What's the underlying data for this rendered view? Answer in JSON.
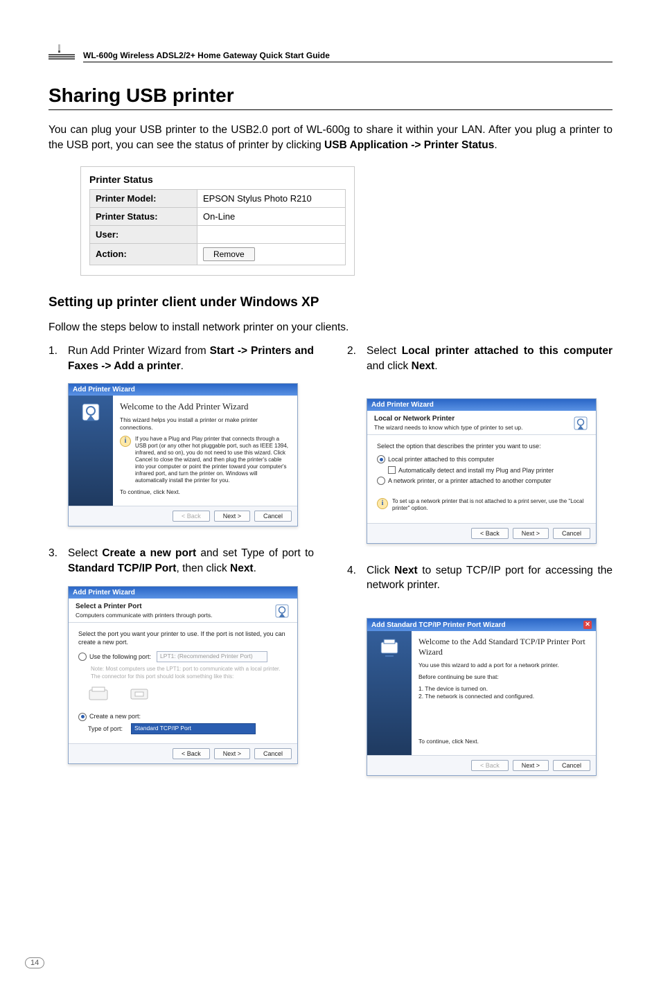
{
  "header": {
    "doc_title": "WL-600g Wireless ADSL2/2+ Home Gateway Quick Start Guide"
  },
  "h1": "Sharing USB printer",
  "intro_pre": "You can plug your USB printer to the USB2.0 port of WL-600g to share it within your LAN. After you plug a printer to the USB port, you can see the status of printer by clicking ",
  "intro_bold": "USB Application ->  Printer Status",
  "intro_post": ".",
  "printer_status": {
    "title": "Printer Status",
    "rows": [
      {
        "label": "Printer Model:",
        "value": "EPSON Stylus Photo R210"
      },
      {
        "label": "Printer Status:",
        "value": "On-Line"
      },
      {
        "label": "User:",
        "value": ""
      },
      {
        "label": "Action:",
        "value_button": "Remove"
      }
    ]
  },
  "h2": "Setting up printer client under Windows XP",
  "subtext": "Follow the steps below to install network printer on your clients.",
  "steps": {
    "s1": {
      "num": "1.",
      "pre": "Run Add Printer Wizard from ",
      "bold": "Start -> Printers and Faxes -> Add a printer",
      "post": "."
    },
    "s2": {
      "num": "2.",
      "pre": "Select ",
      "bold": "Local printer attached to this computer",
      "mid": " and click ",
      "bold2": "Next",
      "post": "."
    },
    "s3": {
      "num": "3.",
      "pre": "Select ",
      "bold": "Create a new port",
      "mid": " and set Type of port to ",
      "bold2": "Standard TCP/IP Port",
      "mid2": ", then click ",
      "bold3": "Next",
      "post": "."
    },
    "s4": {
      "num": "4.",
      "pre": "Click ",
      "bold": "Next",
      "mid": " to setup TCP/IP port for accessing the network printer.",
      "post": ""
    }
  },
  "wiz1": {
    "title": "Add Printer Wizard",
    "h": "Welcome to the Add Printer Wizard",
    "sub": "This wizard helps you install a printer or make printer connections.",
    "info": "If you have a Plug and Play printer that connects through a USB port (or any other hot pluggable port, such as IEEE 1394, infrared, and so on), you do not need to use this wizard. Click Cancel to close the wizard, and then plug the printer's cable into your computer or point the printer toward your computer's infrared port, and turn the printer on. Windows will automatically install the printer for you.",
    "cont": "To continue, click Next.",
    "btn_back": "< Back",
    "btn_next": "Next >",
    "btn_cancel": "Cancel"
  },
  "wiz2": {
    "title": "Add Printer Wizard",
    "head_t": "Local or Network Printer",
    "head_s": "The wizard needs to know which type of printer to set up.",
    "lead": "Select the option that describes the printer you want to use:",
    "opt1": "Local printer attached to this computer",
    "chk1": "Automatically detect and install my Plug and Play printer",
    "opt2": "A network printer, or a printer attached to another computer",
    "info": "To set up a network printer that is not attached to a print server, use the \"Local printer\" option.",
    "btn_back": "< Back",
    "btn_next": "Next >",
    "btn_cancel": "Cancel"
  },
  "wiz3": {
    "title": "Add Printer Wizard",
    "head_t": "Select a Printer Port",
    "head_s": "Computers communicate with printers through ports.",
    "lead": "Select the port you want your printer to use. If the port is not listed, you can create a new port.",
    "opt1": "Use the following port:",
    "opt1_val": "LPT1: (Recommended Printer Port)",
    "note": "Note: Most computers use the LPT1: port to communicate with a local printer. The connector for this port should look something like this:",
    "opt2": "Create a new port:",
    "type_label": "Type of port:",
    "type_val": "Standard TCP/IP Port",
    "btn_back": "< Back",
    "btn_next": "Next >",
    "btn_cancel": "Cancel"
  },
  "wiz4": {
    "title": "Add Standard TCP/IP Printer Port Wizard",
    "h": "Welcome to the Add Standard TCP/IP Printer Port Wizard",
    "sub": "You use this wizard to add a port for a network printer.",
    "before": "Before continuing be sure that:",
    "b1": "1.  The device is turned on.",
    "b2": "2.  The network is connected and configured.",
    "cont": "To continue, click Next.",
    "btn_back": "< Back",
    "btn_next": "Next >",
    "btn_cancel": "Cancel"
  },
  "page_number": "14"
}
